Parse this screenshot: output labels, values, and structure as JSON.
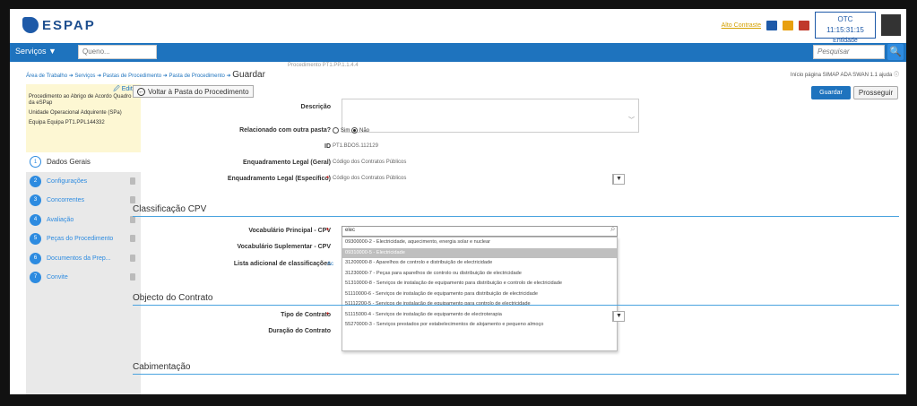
{
  "header": {
    "logo_text": "ESPAP",
    "user_link": "Alto Contraste",
    "clock": "OTC 11:15:31:15",
    "entity": "Entidade Adquirente"
  },
  "nav": {
    "menu_label": "Serviços ▼",
    "search_placeholder": "Queno...",
    "search_right_placeholder": "Pesquisar",
    "search_button": "🔍"
  },
  "breadcrumb": {
    "path": "Área de Trabalho ➜ Serviços ➜ Pastas de Procedimento ➜ Pasta de Procedimento ➜",
    "current": "Guardar",
    "right": "Início página  SIMAP ADA  SWAN 1.1 ajuda ⓘ",
    "faint_top": "Procedimento  PT1.PP.1.1.4.4"
  },
  "info_box": {
    "edit": "🖉 Editar",
    "procedure": "Procedimento ao Abrigo de Acordo Quadro da eSPap",
    "unit": "Unidade Operacional Adquirente (SPa)",
    "team": "Equipa Equipa PT1.PPL144332"
  },
  "steps": [
    {
      "num": "1",
      "label": "Dados Gerais",
      "active": true
    },
    {
      "num": "2",
      "label": "Configurações",
      "active": false
    },
    {
      "num": "3",
      "label": "Concorrentes",
      "active": false
    },
    {
      "num": "4",
      "label": "Avaliação",
      "active": false
    },
    {
      "num": "5",
      "label": "Peças do Procedimento",
      "active": false
    },
    {
      "num": "6",
      "label": "Documentos da Prep...",
      "active": false
    },
    {
      "num": "7",
      "label": "Convite",
      "active": false
    }
  ],
  "actions": {
    "back": "Voltar à Pasta do Procedimento",
    "save": "Guardar",
    "next": "Prosseguir"
  },
  "form": {
    "descricao_label": "Descrição",
    "relacionado_label": "Relacionado com outra pasta?",
    "opt_sim": "Sim",
    "opt_nao": "Não",
    "id_label": "ID",
    "id_value": "PT1.BDOS.112129",
    "enq_geral_label": "Enquadramento Legal (Geral)",
    "enq_geral_value": "Código dos Contratos Públicos",
    "enq_esp_label": "Enquadramento Legal (Específico)",
    "enq_esp_value": "Código dos Contratos Públicos"
  },
  "cpv": {
    "section_title": "Classificação CPV",
    "principal_label": "Vocabulário Principal - CPV",
    "principal_value": "elec",
    "suplementar_label": "Vocabulário Suplementar - CPV",
    "lista_label": "Lista adicional de classificações",
    "lista_link": "Ac",
    "dropdown": [
      "09300000-2 - Electricidade, aquecimento, energia solar e nuclear",
      "09310000-5 - Electricidade",
      "31200000-8 - Aparelhos de controlo e distribuição de electricidade",
      "31230000-7 - Peças para aparelhos de controlo ou distribuição de electricidade",
      "51310000-8 - Serviços de instalação de equipamento para distribuição e controlo de electricidade",
      "51110000-6 - Serviços de instalação de equipamento para distribuição de electricidade",
      "51112200-5 - Serviços de instalação de equipamento para controlo de electricidade",
      "51115000-4 - Serviços de instalação de equipamento de electroterapia",
      "55270000-3 - Serviços prestados por estabelecimentos de alojamento e pequeno almoço"
    ],
    "selected_index": 1
  },
  "objecto": {
    "section_title": "Objecto do Contrato",
    "tipo_label": "Tipo de Contrato",
    "duracao_label": "Duração do Contrato"
  },
  "cabimentacao": {
    "section_title": "Cabimentação"
  },
  "colors": {
    "primary": "#1e73be",
    "accent": "#2d8be0",
    "highlight": "#fdf7d3"
  }
}
